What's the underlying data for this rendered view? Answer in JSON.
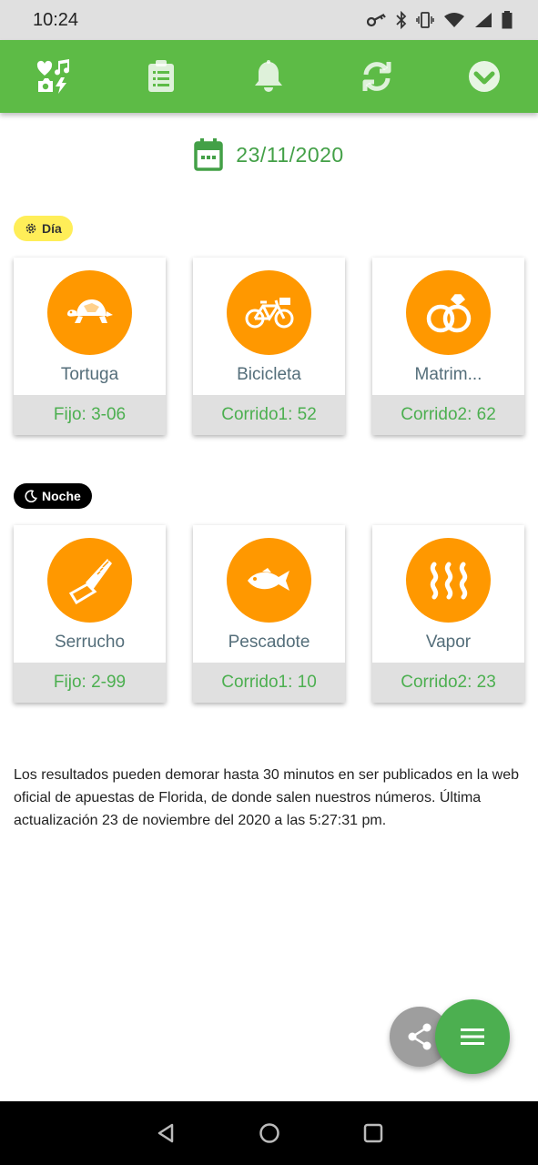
{
  "status_bar": {
    "time": "10:24",
    "icons": [
      "key-icon",
      "bluetooth-icon",
      "vibrate-icon",
      "wifi-icon",
      "signal-icon",
      "battery-icon"
    ]
  },
  "app_bar": {
    "color": "#5dbb46",
    "tabs": [
      {
        "icon": "charada-icon"
      },
      {
        "icon": "clipboard-list-icon"
      },
      {
        "icon": "bell-icon"
      },
      {
        "icon": "refresh-icon"
      },
      {
        "icon": "chevron-down-circle-icon"
      }
    ]
  },
  "date": {
    "icon": "calendar-icon",
    "text": "23/11/2020"
  },
  "dia": {
    "badge_label": "Día",
    "badge_icon": "gear-icon",
    "cards": [
      {
        "name": "Tortuga",
        "result": "Fijo: 3-06",
        "icon": "turtle-icon"
      },
      {
        "name": "Bicicleta",
        "result": "Corrido1: 52",
        "icon": "bicycle-icon"
      },
      {
        "name": "Matrim...",
        "result": "Corrido2: 62",
        "icon": "rings-icon"
      }
    ]
  },
  "noche": {
    "badge_label": "Noche",
    "badge_icon": "moon-icon",
    "cards": [
      {
        "name": "Serrucho",
        "result": "Fijo: 2-99",
        "icon": "saw-icon"
      },
      {
        "name": "Pescadote",
        "result": "Corrido1: 10",
        "icon": "fish-icon"
      },
      {
        "name": "Vapor",
        "result": "Corrido2: 23",
        "icon": "steam-icon"
      }
    ]
  },
  "disclaimer": "Los resultados pueden demorar hasta 30 minutos en ser publicados en la web oficial de apuestas de Florida, de donde salen nuestros números. Última actualización 23 de noviembre del 2020 a las 5:27:31 pm.",
  "fab": {
    "share_icon": "share-icon",
    "menu_icon": "menu-icon"
  },
  "colors": {
    "accent": "#4caf50",
    "orange": "#ff9800",
    "dia_badge": "#ffee58",
    "noche_badge": "#000000"
  }
}
